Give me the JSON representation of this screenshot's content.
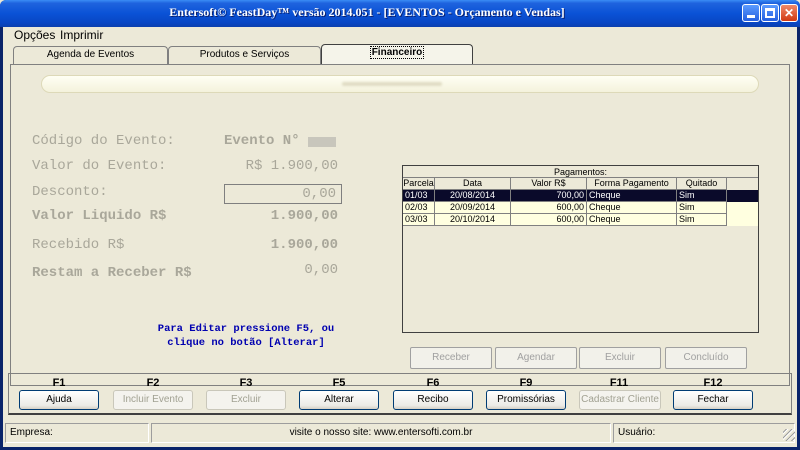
{
  "window": {
    "title": "Entersoft© FeastDay™ versão 2014.051 - [EVENTOS - Orçamento e Vendas]",
    "close_label": "✕"
  },
  "menu": [
    "Opções",
    "Imprimir"
  ],
  "tabs": [
    {
      "label": "Agenda de Eventos",
      "active": false
    },
    {
      "label": "Produtos e Serviços",
      "active": false
    },
    {
      "label": "Financeiro",
      "active": true
    }
  ],
  "financeiro": {
    "codigo_label": "Código do Evento:",
    "codigo_value": "Evento N°",
    "valor_evento_label": "Valor do Evento:",
    "valor_evento_value": "R$ 1.900,00",
    "desconto_label": "Desconto:",
    "desconto_value": "0,00",
    "valor_liquido_label": "Valor Liquido R$",
    "valor_liquido_value": "1.900,00",
    "recebido_label": "Recebido R$",
    "recebido_value": "1.900,00",
    "restam_label": "Restam a Receber R$",
    "restam_value": "0,00",
    "hint_line1": "Para Editar pressione F5, ou",
    "hint_line2": "clique no botão [Alterar]"
  },
  "pagamentos": {
    "title": "Pagamentos:",
    "columns": [
      "Parcela",
      "Data",
      "Valor R$",
      "Forma Pagamento",
      "Quitado"
    ],
    "rows": [
      [
        "01/03",
        "20/08/2014",
        "700,00",
        "Cheque",
        "Sim"
      ],
      [
        "02/03",
        "20/09/2014",
        "600,00",
        "Cheque",
        "Sim"
      ],
      [
        "03/03",
        "20/10/2014",
        "600,00",
        "Cheque",
        "Sim"
      ]
    ],
    "buttons": {
      "receber": "Receber",
      "agendar": "Agendar",
      "excluir": "Excluir",
      "concluido": "Concluído"
    }
  },
  "fkeys": [
    {
      "key": "F1",
      "label": "Ajuda",
      "enabled": true
    },
    {
      "key": "F2",
      "label": "Incluir Evento",
      "enabled": false
    },
    {
      "key": "F3",
      "label": "Excluir",
      "enabled": false
    },
    {
      "key": "F5",
      "label": "Alterar",
      "enabled": true
    },
    {
      "key": "F6",
      "label": "Recibo",
      "enabled": true
    },
    {
      "key": "F9",
      "label": "Promissórias",
      "enabled": true
    },
    {
      "key": "F11",
      "label": "Cadastrar Cliente",
      "enabled": false
    },
    {
      "key": "F12",
      "label": "Fechar",
      "enabled": true
    }
  ],
  "status": {
    "empresa": "Empresa:",
    "site": "visite o nosso site: www.entersofti.com.br",
    "usuario": "Usuário:"
  }
}
